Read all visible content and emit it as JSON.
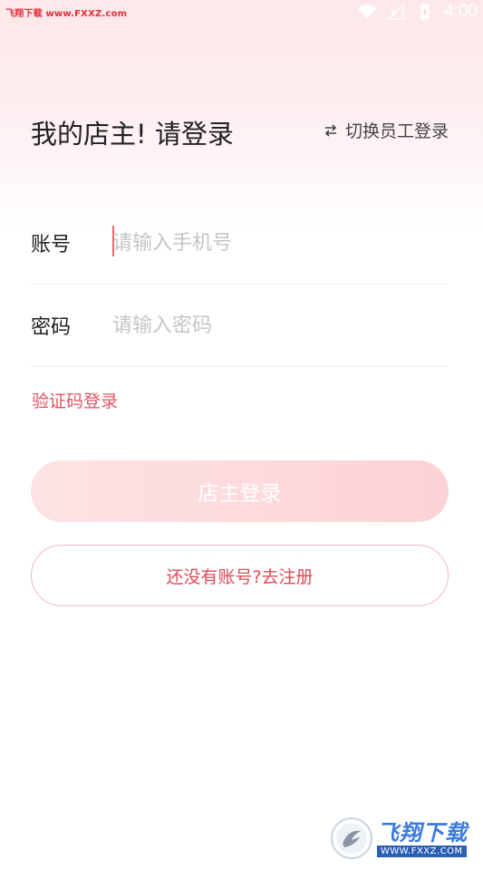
{
  "status_bar": {
    "watermark_text": "飞翔下载 www.FXXZ.com",
    "time": "4:00"
  },
  "header": {
    "title": "我的店主! 请登录",
    "switch_label": "切换员工登录"
  },
  "form": {
    "account": {
      "label": "账号",
      "placeholder": "请输入手机号",
      "value": ""
    },
    "password": {
      "label": "密码",
      "placeholder": "请输入密码",
      "value": ""
    },
    "code_login_label": "验证码登录"
  },
  "actions": {
    "login_label": "店主登录",
    "register_label": "还没有账号?去注册"
  },
  "watermark": {
    "brand": "飞翔下载",
    "url": "WWW.FXXZ.COM"
  },
  "colors": {
    "accent": "#e25561",
    "login_button_start": "#fde3e5",
    "login_button_end": "#fdd2d4",
    "register_border": "#f2b7bc"
  },
  "icons": {
    "switch": "swap-arrows-icon",
    "status_wifi": "wifi-icon",
    "status_signal": "signal-icon",
    "status_battery": "battery-icon"
  }
}
